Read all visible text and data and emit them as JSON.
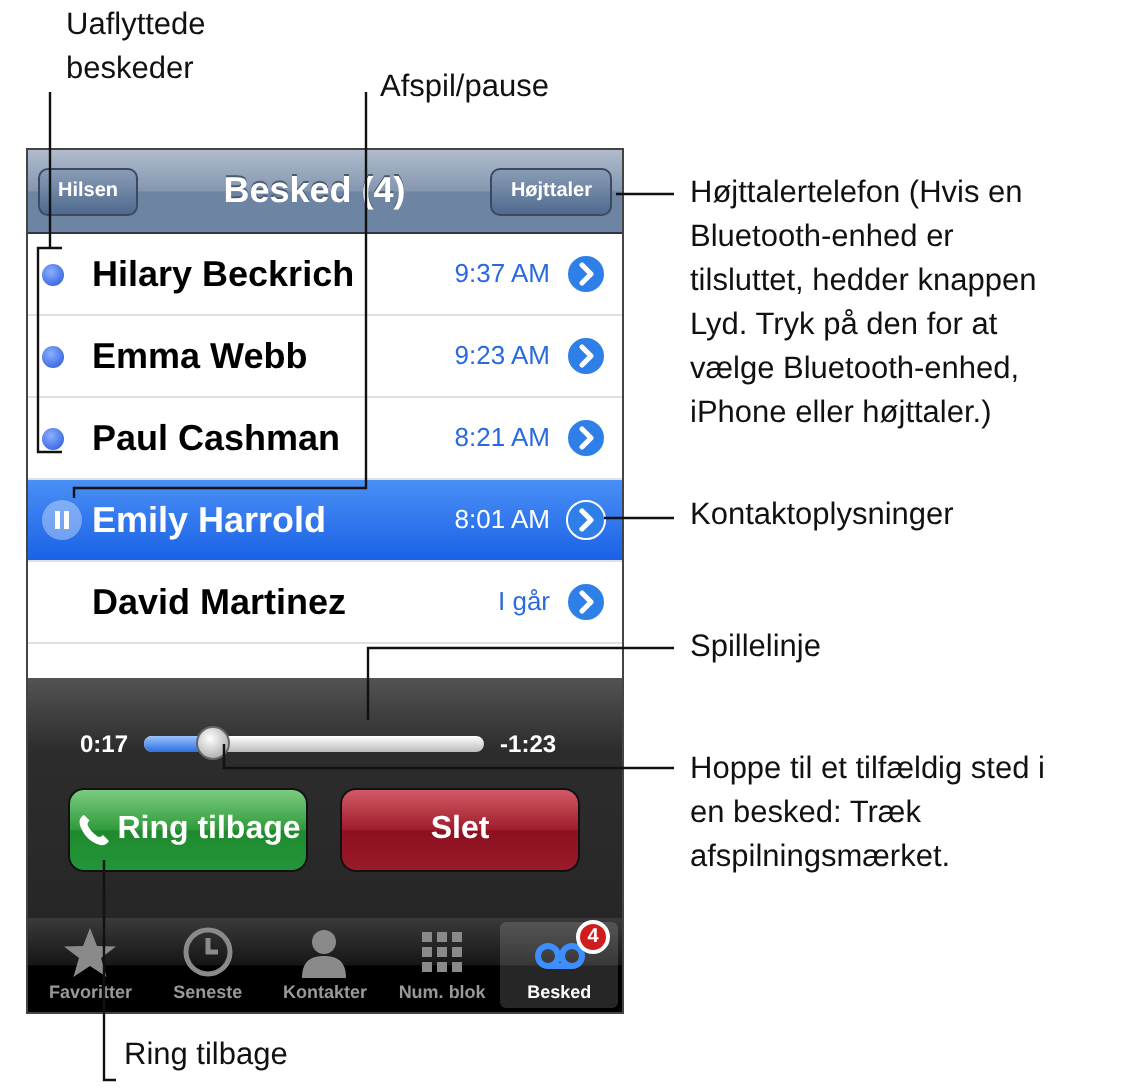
{
  "callouts": [
    {
      "text": "Uaflyttede\nbeskeder"
    },
    {
      "text": "Afspil/pause"
    },
    {
      "text": "Højttalertelefon (Hvis en\nBluetooth-enhed er\ntilsluttet, hedder knappen\nLyd. Tryk på den for at\nvælge Bluetooth-enhed,\niPhone eller højttaler.)"
    },
    {
      "text": "Kontaktoplysninger"
    },
    {
      "text": "Spillelinje"
    },
    {
      "text": "Hoppe til et tilfældig sted i\nen besked: Træk\nafspilningsmærket."
    },
    {
      "text": "Ring tilbage"
    }
  ],
  "phone": {
    "nav": {
      "left_button": "Hilsen",
      "title": "Besked (4)",
      "right_button": "Højttaler"
    },
    "messages": [
      {
        "name": "Hilary Beckrich",
        "time": "9:37 AM",
        "unread": true,
        "selected": false
      },
      {
        "name": "Emma Webb",
        "time": "9:23 AM",
        "unread": true,
        "selected": false
      },
      {
        "name": "Paul Cashman",
        "time": "8:21 AM",
        "unread": true,
        "selected": false
      },
      {
        "name": "Emily Harrold",
        "time": "8:01 AM",
        "unread": false,
        "selected": true
      },
      {
        "name": "David Martinez",
        "time": "I går",
        "unread": false,
        "selected": false
      }
    ],
    "player": {
      "elapsed": "0:17",
      "remaining": "-1:23",
      "level": 0.2
    },
    "buttons": [
      {
        "kind": "call",
        "label": "Ring tilbage"
      },
      {
        "kind": "delete",
        "label": "Slet"
      }
    ],
    "tabs": [
      {
        "kind": "star",
        "label": "Favoritter",
        "selected": false
      },
      {
        "kind": "clock",
        "label": "Seneste",
        "selected": false
      },
      {
        "kind": "person",
        "label": "Kontakter",
        "selected": false
      },
      {
        "kind": "keypad",
        "label": "Num. blok",
        "selected": false
      },
      {
        "kind": "voicemail",
        "label": "Besked",
        "selected": true,
        "badge": "4"
      }
    ]
  }
}
